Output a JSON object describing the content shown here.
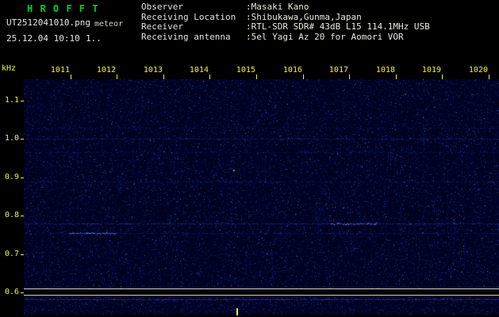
{
  "header": {
    "app_title": "H R O F F T",
    "filename": "UT2512041010.png",
    "session_label": "meteor",
    "datetime": "25.12.04 10:10",
    "counter": "1..",
    "info": [
      {
        "label": "Observer",
        "value": ":Masaki Kano"
      },
      {
        "label": "Receiving Location",
        "value": ":Shibukawa,Gunma,Japan"
      },
      {
        "label": "Receiver",
        "value": ":RTL-SDR SDR# 43dB L15 114.1MHz USB"
      },
      {
        "label": "Receiving antenna",
        "value": ":5el Yagi Az 20 for Aomori VOR"
      }
    ]
  },
  "chart_data": {
    "type": "heatmap",
    "title": "HROFFT 10-minute radio meteor observation spectrogram, 25.12.04 10:10-10:20 UT",
    "ylabel": "kHz",
    "y_ticks": [
      "1.1",
      "1.0",
      "0.9",
      "0.8",
      "0.7",
      "0.6"
    ],
    "y_range_khz": [
      0.59,
      1.16
    ],
    "x_ticks": [
      "1011",
      "1012",
      "1013",
      "1014",
      "1015",
      "1016",
      "1017",
      "1018",
      "1019",
      "1020"
    ],
    "x_range_ut": [
      "10:10",
      "10:20"
    ],
    "grid": false,
    "legend": "none",
    "content": "Dark blue noise floor with faint continuous horizontal carrier lines; brightest carrier segment near 0.78 kHz around 10:16-10:17; narrow signal-level strip along the bottom; no strong meteor echoes.",
    "carrier_lines": [
      {
        "khz": 1.03,
        "intensity": 0.15
      },
      {
        "khz": 1.0,
        "intensity": 0.42
      },
      {
        "khz": 0.965,
        "intensity": 0.2
      },
      {
        "khz": 0.89,
        "intensity": 0.3
      },
      {
        "khz": 0.78,
        "intensity": 0.6,
        "bright_segment_min": [
          6.6,
          7.6
        ]
      },
      {
        "khz": 0.755,
        "intensity": 0.3,
        "bright_segment_min": [
          0.95,
          2.0
        ]
      }
    ],
    "echo_spots": [
      {
        "time_min": 4.5,
        "khz": 0.92
      }
    ],
    "colors": {
      "bg": "#000021",
      "noise": [
        "#071a4d",
        "#0a2a7d",
        "#1c3fae",
        "#2f5bd8",
        "#5e86ff"
      ],
      "streak": "#1c3fae",
      "carrier": "#2e55e8",
      "bright": "#6fa0ff",
      "echo_green": "#2fd45f",
      "axis_yellow": "#f0f046",
      "title_green": "#00cc33",
      "text_white": "#e4e4e4",
      "separator_white": "#cfcfcf"
    }
  }
}
